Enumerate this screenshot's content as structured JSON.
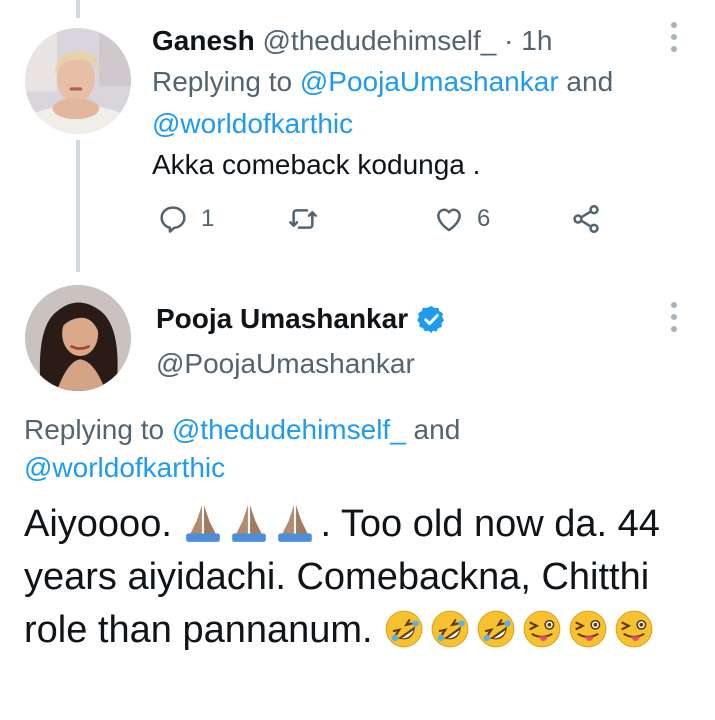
{
  "reply_tweet": {
    "author_name": "Ganesh",
    "author_handle": "@thedudehimself_",
    "time": "· 1h",
    "replying_prefix": "Replying to ",
    "replying_user_1": "@PoojaUmashankar",
    "replying_and": " and",
    "replying_user_2": "@worldofkarthic",
    "text": "Akka comeback kodunga .",
    "reply_count": "1",
    "retweet_count": "",
    "like_count": "6"
  },
  "main_tweet": {
    "author_name": "Pooja Umashankar",
    "author_handle": "@PoojaUmashankar",
    "verified": true,
    "replying_prefix": "Replying to ",
    "replying_user_1": "@thedudehimself_",
    "replying_and": " and",
    "replying_user_2": "@worldofkarthic",
    "text_part1": "Aiyoooo. ",
    "text_part2": ". Too old now da. 44 years aiyidachi. Comebackna, Chitthi role than pannanum. ",
    "emoji_folded_hands": "folded-hands-icon ×3",
    "emoji_rolling_laughing": "rolling-laughing-icon ×3",
    "emoji_winking_tongue": "winking-tongue-icon ×3"
  },
  "colors": {
    "text": "#0f1419",
    "secondary": "#536471",
    "link": "#1d9bf0",
    "thread_line": "#cfd9de",
    "verified": "#1d9bf0"
  }
}
